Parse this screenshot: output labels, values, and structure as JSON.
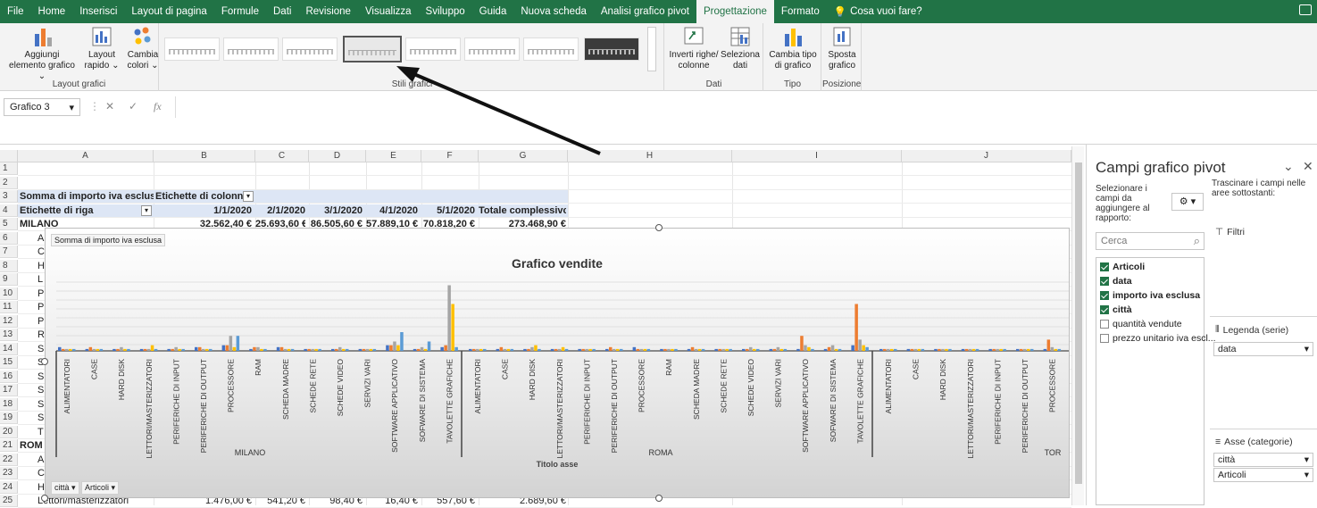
{
  "menu": {
    "items": [
      "File",
      "Home",
      "Inserisci",
      "Layout di pagina",
      "Formule",
      "Dati",
      "Revisione",
      "Visualizza",
      "Sviluppo",
      "Guida",
      "Nuova scheda",
      "Analisi grafico pivot",
      "Progettazione",
      "Formato"
    ],
    "active_index": 12,
    "search_placeholder": "Cosa vuoi fare?"
  },
  "ribbon": {
    "layout": {
      "add_element": "Aggiungi elemento grafico",
      "quick_layout": "Layout rapido",
      "group": "Layout grafici"
    },
    "colors": {
      "label": "Cambia colori"
    },
    "styles": {
      "group": "Stili grafici"
    },
    "data": {
      "switch_rows": "Inverti righe/ colonne",
      "select_data": "Seleziona dati",
      "group": "Dati"
    },
    "type": {
      "change_type": "Cambia tipo di grafico",
      "group": "Tipo"
    },
    "location": {
      "move": "Sposta grafico",
      "group": "Posizione"
    }
  },
  "formula": {
    "name_box": "Grafico 3",
    "fx": "fx",
    "value": ""
  },
  "sheet": {
    "columns": [
      "A",
      "B",
      "C",
      "D",
      "E",
      "F",
      "G",
      "H",
      "I",
      "J"
    ],
    "rows": [
      "1",
      "2",
      "3",
      "4",
      "5",
      "6",
      "7",
      "8",
      "9",
      "10",
      "11",
      "12",
      "13",
      "14",
      "15",
      "16",
      "17",
      "18",
      "19",
      "20",
      "21",
      "22",
      "23",
      "24",
      "25"
    ],
    "a3": "Somma di importo iva esclusa",
    "b3": "Etichette di colonna",
    "a4": "Etichette di riga",
    "date_headers": [
      "1/1/2020",
      "2/1/2020",
      "3/1/2020",
      "4/1/2020",
      "5/1/2020"
    ],
    "total_header": "Totale complessivo",
    "row5": {
      "label": "MILANO",
      "values": [
        "32.562,40 €",
        "25.693,60 €",
        "86.505,60 €",
        "57.889,10 €",
        "70.818,20 €"
      ],
      "total": "273.468,90 €"
    },
    "partial_a": [
      "A",
      "C",
      "H",
      "L",
      "P",
      "P",
      "P",
      "R",
      "S",
      "S",
      "S",
      "S",
      "S",
      "S",
      "T"
    ],
    "row21_label": "ROM",
    "partial_a2": [
      "A",
      "C",
      "H"
    ],
    "row25": {
      "label": "Lettori/masterizzatori",
      "values": [
        "1.476,00 €",
        "541,20 €",
        "98,40 €",
        "16,40 €",
        "557,60 €"
      ],
      "total": "2.689,60 €"
    }
  },
  "chart": {
    "value_button": "Somma di importo iva esclusa",
    "title": "Grafico vendite",
    "axis_title": "Titolo asse",
    "axis_buttons": [
      "città",
      "Articoli"
    ],
    "chart_data": {
      "type": "bar",
      "title": "Grafico vendite",
      "xlabel": "Titolo asse",
      "ylabel": "",
      "grid": true,
      "legend": "none",
      "groups": [
        "MILANO",
        "ROMA",
        "TOR"
      ],
      "categories": [
        "ALIMENTATORI",
        "CASE",
        "HARD DISK",
        "LETTORI/MASTERIZZATORI",
        "PERIFERICHE DI INPUT",
        "PERIFERICHE DI OUTPUT",
        "PROCESSORE",
        "RAM",
        "SCHEDA MADRE",
        "SCHEDE RETE",
        "SCHEDE VIDEO",
        "SERVIZI VARI",
        "SOFTWARE APPLICATIVO",
        "SOFWARE DI SISTEMA",
        "TAVOLETTE GRAFICHE"
      ],
      "series_colors": [
        "#4472c4",
        "#ed7d31",
        "#a5a5a5",
        "#ffc000",
        "#5b9bd5"
      ],
      "milano": [
        [
          2,
          1,
          1,
          1,
          1
        ],
        [
          1,
          2,
          1,
          1,
          1
        ],
        [
          1,
          1,
          2,
          1,
          1
        ],
        [
          1,
          1,
          1,
          3,
          1
        ],
        [
          1,
          1,
          2,
          1,
          1
        ],
        [
          2,
          2,
          1,
          1,
          1
        ],
        [
          3,
          3,
          8,
          2,
          8
        ],
        [
          1,
          2,
          2,
          1,
          1
        ],
        [
          2,
          2,
          1,
          1,
          1
        ],
        [
          1,
          1,
          1,
          1,
          1
        ],
        [
          1,
          1,
          2,
          1,
          1
        ],
        [
          1,
          1,
          1,
          1,
          1
        ],
        [
          3,
          3,
          5,
          3,
          10
        ],
        [
          1,
          1,
          2,
          1,
          5
        ],
        [
          2,
          3,
          35,
          25,
          2
        ]
      ],
      "roma": [
        [
          1,
          1,
          1,
          1,
          1
        ],
        [
          1,
          2,
          1,
          1,
          1
        ],
        [
          1,
          1,
          2,
          3,
          1
        ],
        [
          1,
          1,
          1,
          2,
          1
        ],
        [
          1,
          1,
          1,
          1,
          1
        ],
        [
          1,
          2,
          1,
          1,
          1
        ],
        [
          2,
          1,
          1,
          1,
          1
        ],
        [
          1,
          1,
          1,
          1,
          1
        ],
        [
          1,
          2,
          1,
          1,
          1
        ],
        [
          1,
          1,
          1,
          1,
          1
        ],
        [
          1,
          1,
          2,
          1,
          1
        ],
        [
          1,
          1,
          2,
          1,
          1
        ],
        [
          1,
          8,
          3,
          2,
          1
        ],
        [
          1,
          2,
          3,
          1,
          1
        ],
        [
          3,
          25,
          6,
          3,
          2
        ]
      ],
      "tor": [
        [
          1,
          1,
          1,
          1,
          1
        ],
        [
          1,
          1,
          1,
          1,
          1
        ],
        [
          1,
          1,
          1,
          1,
          1
        ],
        [
          1,
          1,
          1,
          1,
          1
        ],
        [
          1,
          1,
          1,
          1,
          1
        ],
        [
          1,
          1,
          1,
          1,
          1
        ],
        [
          1,
          6,
          2,
          1,
          1
        ],
        [
          1,
          1,
          1,
          1,
          1
        ]
      ]
    }
  },
  "pane": {
    "title": "Campi grafico pivot",
    "select_text": "Selezionare i campi da aggiungere al rapporto:",
    "drag_text": "Trascinare i campi nelle aree sottostanti:",
    "search_placeholder": "Cerca",
    "fields": [
      {
        "label": "Articoli",
        "checked": true
      },
      {
        "label": "data",
        "checked": true
      },
      {
        "label": "importo iva esclusa",
        "checked": true
      },
      {
        "label": "città",
        "checked": true
      },
      {
        "label": "quantità vendute",
        "checked": false
      },
      {
        "label": "prezzo unitario iva escl...",
        "checked": false
      }
    ],
    "filters_label": "Filtri",
    "legend_label": "Legenda (serie)",
    "legend_value": "data",
    "axis_label": "Asse (categorie)",
    "axis_values": [
      "città",
      "Articoli"
    ]
  }
}
